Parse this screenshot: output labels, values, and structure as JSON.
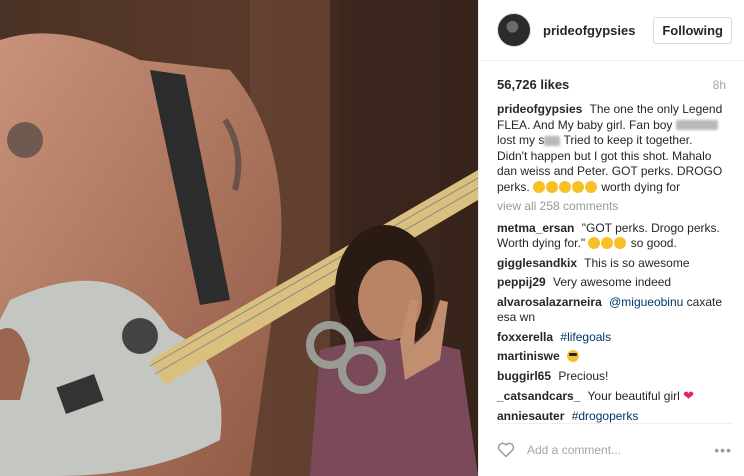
{
  "post": {
    "username": "prideofgypsies",
    "follow_label": "Following",
    "likes": "56,726 likes",
    "time": "8h",
    "caption": {
      "user": "prideofgypsies",
      "text1": "The one the only Legend FLEA. And My baby girl. Fan boy",
      "text2": "lost my s",
      "text3": "Tried to keep it together. Didn't happen but I got this shot. Mahalo dan weiss and Peter. GOT perks. DROGO perks.",
      "text4": "worth dying for"
    },
    "view_all": "view all 258 comments",
    "comments": [
      {
        "user": "metma_ersan",
        "text": "\"GOT perks. Drogo perks. Worth dying for.\"",
        "text_after": "so good."
      },
      {
        "user": "gigglesandkix",
        "text": "This is so awesome"
      },
      {
        "user": "peppij29",
        "text": "Very awesome indeed"
      },
      {
        "user": "alvarosalazarneira",
        "mention": "@migueobinu",
        "text": "caxate esa wn"
      },
      {
        "user": "foxxerella",
        "tag": "#lifegoals"
      },
      {
        "user": "martiniswe"
      },
      {
        "user": "buggirl65",
        "text": "Precious!"
      },
      {
        "user": "_catsandcars_",
        "text": "Your beautiful girl"
      },
      {
        "user": "anniesauter",
        "tag": "#drogoperks"
      }
    ],
    "add_comment_placeholder": "Add a comment...",
    "more_label": "•••",
    "icons": [
      "heart-icon",
      "more-options-icon",
      "emoji-icon",
      "sunglasses-emoji-icon"
    ],
    "colors": {
      "link": "#003569",
      "heart": "#e0245e",
      "muted": "#a5a5a5",
      "text": "#262626"
    }
  }
}
